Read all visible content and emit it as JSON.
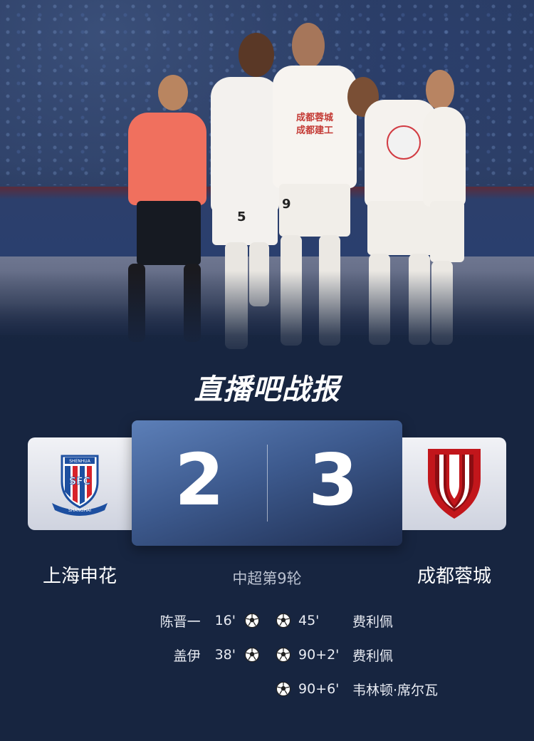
{
  "headline": {
    "brand_part1": "直播吧战",
    "brand_part2": "报"
  },
  "match": {
    "home_team": "上海申花",
    "away_team": "成都蓉城",
    "home_score": "2",
    "away_score": "3",
    "round": "中超第9轮"
  },
  "goals": {
    "home": [
      {
        "player": "陈晋一",
        "minute": "16'"
      },
      {
        "player": "盖伊",
        "minute": "38'"
      }
    ],
    "away": [
      {
        "player": "费利佩",
        "minute": "45'"
      },
      {
        "player": "费利佩",
        "minute": "90+2'"
      },
      {
        "player": "韦林顿·席尔瓦",
        "minute": "90+6'"
      }
    ]
  },
  "crests": {
    "home_letters": "SFC",
    "home_top": "SHENHUA",
    "home_bottom": "SHANGHAI",
    "home_colors": [
      "#1d4fa0",
      "#d8232a",
      "#ffffff"
    ],
    "away_colors": [
      "#c2161b",
      "#ffffff"
    ]
  },
  "photo": {
    "sponsor_line1": "成都蓉城",
    "sponsor_line2": "成都建工",
    "number_5": "5",
    "number_9": "9"
  },
  "colors": {
    "background": "#172540",
    "accent": "#3fe0c8"
  }
}
